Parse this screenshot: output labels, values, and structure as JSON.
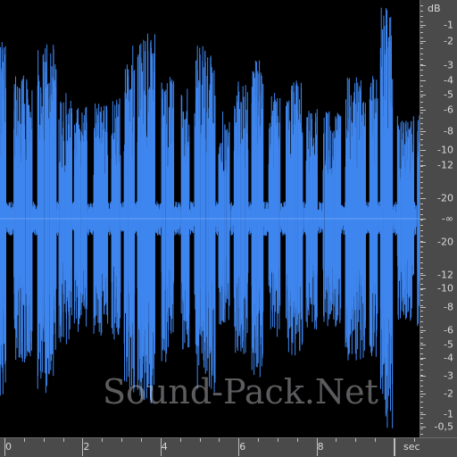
{
  "colors": {
    "waveform": "#3f86ef",
    "background": "#000000",
    "ruler": "#4a4a4a",
    "ruler_text": "#d8d8d8"
  },
  "db_ruler": {
    "unit": "dB",
    "labels": [
      "-1",
      "-2",
      "-3",
      "-4",
      "-5",
      "-6",
      "-8",
      "-10",
      "-12",
      "-20",
      "-∞",
      "-20",
      "-12",
      "-10",
      "-8",
      "-6",
      "-5",
      "-4",
      "-3",
      "-2",
      "-1",
      "-0,5"
    ],
    "values_db": [
      -1,
      -2,
      -3,
      -4,
      -5,
      -6,
      -8,
      -10,
      -12,
      -20,
      null,
      -20,
      -12,
      -10,
      -8,
      -6,
      -5,
      -4,
      -3,
      -2,
      -1,
      -0.5
    ]
  },
  "time_ruler": {
    "unit": "sec",
    "labels": [
      "0",
      "2",
      "4",
      "6",
      "8"
    ],
    "values_sec": [
      0,
      2,
      4,
      6,
      8
    ],
    "visible_end_sec": 10.5
  },
  "watermark": "Sound-Pack.Net"
}
